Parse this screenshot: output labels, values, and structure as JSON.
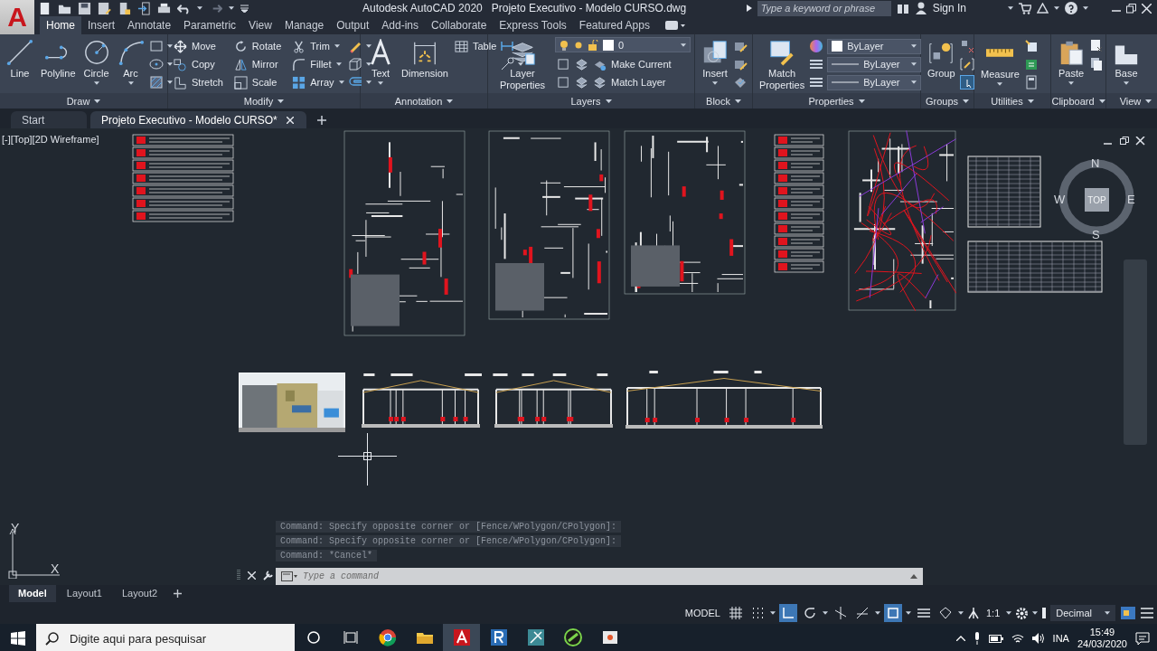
{
  "title_bar": {
    "logo": "A",
    "app_title": "Autodesk AutoCAD 2020",
    "file_title": "Projeto Executivo - Modelo CURSO.dwg",
    "search": {
      "placeholder": "Type a keyword or phrase"
    },
    "sign_in": "Sign In"
  },
  "ribbon_tabs": [
    {
      "label": "Home",
      "selected": true
    },
    {
      "label": "Insert",
      "selected": false
    },
    {
      "label": "Annotate",
      "selected": false
    },
    {
      "label": "Parametric",
      "selected": false
    },
    {
      "label": "View",
      "selected": false
    },
    {
      "label": "Manage",
      "selected": false
    },
    {
      "label": "Output",
      "selected": false
    },
    {
      "label": "Add-ins",
      "selected": false
    },
    {
      "label": "Collaborate",
      "selected": false
    },
    {
      "label": "Express Tools",
      "selected": false
    },
    {
      "label": "Featured Apps",
      "selected": false
    }
  ],
  "ribbon_panels": [
    {
      "title": "Draw",
      "tools": [
        {
          "kind": "large",
          "label": "Line",
          "dropdown": false
        },
        {
          "kind": "large",
          "label": "Polyline",
          "dropdown": false
        },
        {
          "kind": "large",
          "label": "Circle",
          "dropdown": true
        },
        {
          "kind": "large",
          "label": "Arc",
          "dropdown": true
        }
      ]
    },
    {
      "title": "Modify",
      "tools": [
        {
          "kind": "small",
          "label": "Move",
          "dropdown": false
        },
        {
          "kind": "small",
          "label": "Copy",
          "dropdown": false
        },
        {
          "kind": "small",
          "label": "Stretch",
          "dropdown": false
        },
        {
          "kind": "small",
          "label": "Rotate",
          "dropdown": false
        },
        {
          "kind": "small",
          "label": "Mirror",
          "dropdown": false
        },
        {
          "kind": "small",
          "label": "Scale",
          "dropdown": false
        },
        {
          "kind": "small",
          "label": "Trim",
          "dropdown": true
        },
        {
          "kind": "small",
          "label": "Fillet",
          "dropdown": true
        },
        {
          "kind": "small",
          "label": "Array",
          "dropdown": true
        }
      ]
    },
    {
      "title": "Annotation",
      "tools": [
        {
          "kind": "large",
          "label": "Text",
          "dropdown": true
        },
        {
          "kind": "large",
          "label": "Dimension",
          "dropdown": false
        },
        {
          "kind": "small",
          "label": "Table",
          "dropdown": false
        }
      ]
    },
    {
      "title": "Layers",
      "tools": [
        {
          "kind": "large",
          "label": "Layer Properties",
          "dropdown": false
        },
        {
          "kind": "field",
          "value": "0"
        },
        {
          "kind": "small",
          "label": "Make Current",
          "dropdown": false
        },
        {
          "kind": "small",
          "label": "Match Layer",
          "dropdown": false
        }
      ]
    },
    {
      "title": "Block",
      "tools": [
        {
          "kind": "large",
          "label": "Insert",
          "dropdown": true
        }
      ]
    },
    {
      "title": "Properties",
      "tools": [
        {
          "kind": "large",
          "label": "Match Properties",
          "dropdown": false
        },
        {
          "kind": "field",
          "value": "ByLayer"
        },
        {
          "kind": "field",
          "value": "ByLayer"
        },
        {
          "kind": "field",
          "value": "ByLayer"
        }
      ]
    },
    {
      "title": "Groups",
      "tools": [
        {
          "kind": "large",
          "label": "Group",
          "dropdown": false
        }
      ]
    },
    {
      "title": "Utilities",
      "tools": [
        {
          "kind": "large",
          "label": "Measure",
          "dropdown": true
        }
      ]
    },
    {
      "title": "Clipboard",
      "tools": [
        {
          "kind": "large",
          "label": "Paste",
          "dropdown": true
        }
      ]
    },
    {
      "title": "View",
      "tools": [
        {
          "kind": "large",
          "label": "Base",
          "dropdown": true
        }
      ]
    }
  ],
  "file_tabs": [
    {
      "label": "Start",
      "selected": false
    },
    {
      "label": "Projeto Executivo - Modelo CURSO*",
      "selected": true
    }
  ],
  "viewport": {
    "label": "[-][Top][2D Wireframe]",
    "viewcube": {
      "north": "N",
      "south": "S",
      "east": "E",
      "west": "W",
      "face": "TOP"
    },
    "ucs": {
      "x": "X",
      "y": "Y"
    }
  },
  "command_line": {
    "history": [
      "Command: Specify opposite corner or [Fence/WPolygon/CPolygon]:",
      "Command: Specify opposite corner or [Fence/WPolygon/CPolygon]:",
      "Command: *Cancel*"
    ],
    "placeholder": "Type a command"
  },
  "layout_tabs": [
    {
      "label": "Model",
      "selected": true
    },
    {
      "label": "Layout1",
      "selected": false
    },
    {
      "label": "Layout2",
      "selected": false
    }
  ],
  "status_bar": {
    "space": "MODEL",
    "scale": "1:1",
    "units": "Decimal",
    "toggles": [
      {
        "kind": "grid",
        "on": false
      },
      {
        "kind": "snap",
        "on": false
      },
      {
        "kind": "ortho",
        "on": true
      },
      {
        "kind": "polar",
        "on": false
      },
      {
        "kind": "isodraft",
        "on": false
      },
      {
        "kind": "tracking",
        "on": false
      },
      {
        "kind": "osnap",
        "on": true
      },
      {
        "kind": "lineweight",
        "on": false
      },
      {
        "kind": "transparency",
        "on": false
      }
    ]
  },
  "taskbar": {
    "search": {
      "placeholder": "Digite aqui para pesquisar"
    },
    "apps": [
      {
        "kind": "chrome",
        "selected": false
      },
      {
        "kind": "explorer",
        "selected": false
      },
      {
        "kind": "autocad",
        "selected": true
      },
      {
        "kind": "revit",
        "selected": false
      },
      {
        "kind": "recap",
        "selected": false
      },
      {
        "kind": "navisworks",
        "selected": false
      },
      {
        "kind": "presenter",
        "selected": false
      }
    ],
    "language": "INA",
    "time": "15:49",
    "date": "24/03/2020"
  }
}
